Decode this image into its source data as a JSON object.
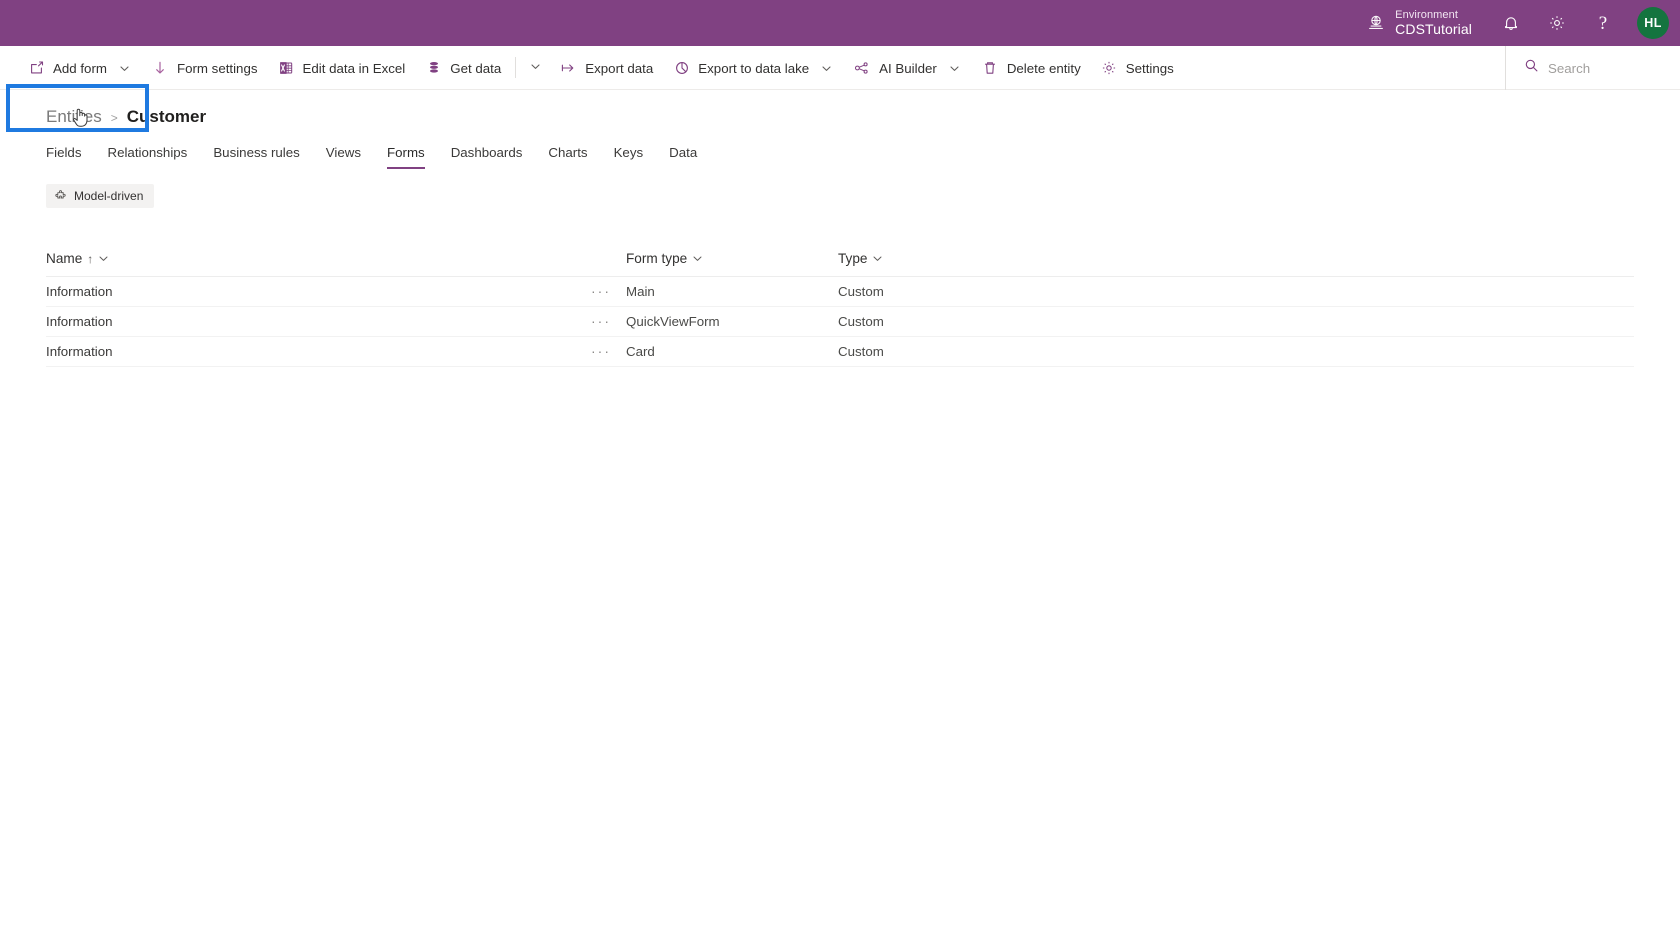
{
  "header": {
    "environment_label": "Environment",
    "environment_name": "CDSTutorial",
    "notifications_icon": "bell-icon",
    "settings_icon": "gear-icon",
    "help_label": "?",
    "avatar_initials": "HL",
    "avatar_color": "#14743f",
    "background_color": "#804182"
  },
  "commandbar": {
    "items": [
      {
        "label": "Add form",
        "icon": "add-form-icon",
        "caret": true
      },
      {
        "label": "Form settings",
        "icon": "download-arrow-icon",
        "caret": false
      },
      {
        "label": "Edit data in Excel",
        "icon": "excel-icon",
        "caret": false
      },
      {
        "label": "Get data",
        "icon": "database-icon",
        "caret": false
      },
      {
        "label": "Export data",
        "icon": "export-arrow-icon",
        "caret": false
      },
      {
        "label": "Export to data lake",
        "icon": "data-lake-icon",
        "caret": true
      },
      {
        "label": "AI Builder",
        "icon": "ai-builder-icon",
        "caret": true
      },
      {
        "label": "Delete entity",
        "icon": "trash-icon",
        "caret": false
      },
      {
        "label": "Settings",
        "icon": "gear-icon",
        "caret": false
      }
    ],
    "overflow_caret": "chevron-down-icon",
    "highlight_target": "Add form",
    "highlight_color": "#1f7ae0"
  },
  "search": {
    "placeholder": "Search",
    "icon": "search-icon"
  },
  "breadcrumb": {
    "parent": "Entities",
    "separator": ">",
    "current": "Customer"
  },
  "tabs": {
    "items": [
      {
        "label": "Fields",
        "active": false
      },
      {
        "label": "Relationships",
        "active": false
      },
      {
        "label": "Business rules",
        "active": false
      },
      {
        "label": "Views",
        "active": false
      },
      {
        "label": "Forms",
        "active": true
      },
      {
        "label": "Dashboards",
        "active": false
      },
      {
        "label": "Charts",
        "active": false
      },
      {
        "label": "Keys",
        "active": false
      },
      {
        "label": "Data",
        "active": false
      }
    ],
    "active_underline_color": "#804182"
  },
  "filter_chip": {
    "label": "Model-driven",
    "icon": "puzzle-piece-icon"
  },
  "table": {
    "columns": [
      {
        "label": "Name",
        "sorted": true,
        "sort_arrow": "↑",
        "caret": "chevron-down-icon"
      },
      {
        "label": "Form type",
        "sorted": false,
        "sort_arrow": "",
        "caret": "chevron-down-icon"
      },
      {
        "label": "Type",
        "sorted": false,
        "sort_arrow": "",
        "caret": "chevron-down-icon"
      }
    ],
    "row_menu_glyph": "···",
    "rows": [
      {
        "name": "Information",
        "form_type": "Main",
        "type": "Custom"
      },
      {
        "name": "Information",
        "form_type": "QuickViewForm",
        "type": "Custom"
      },
      {
        "name": "Information",
        "form_type": "Card",
        "type": "Custom"
      }
    ]
  }
}
